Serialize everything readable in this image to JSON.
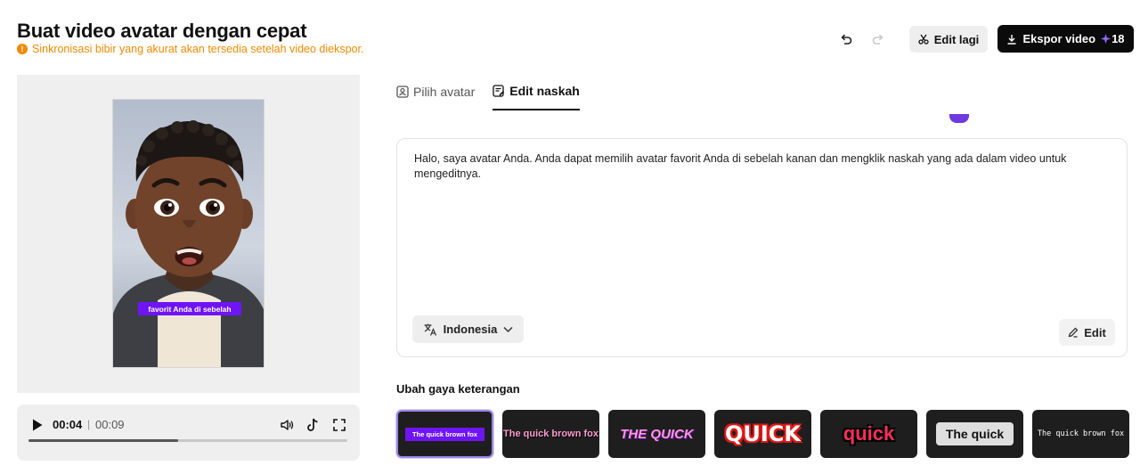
{
  "header": {
    "title": "Buat video avatar dengan cepat",
    "warning": "Sinkronisasi bibir yang akurat akan tersedia setelah video diekspor.",
    "edit_again_label": "Edit lagi",
    "export_label": "Ekspor video",
    "export_credits": "18"
  },
  "preview": {
    "caption": "favorit Anda di sebelah"
  },
  "player": {
    "current_time": "00:04",
    "separator": "|",
    "total_time": "00:09",
    "progress_fraction": 0.47
  },
  "tabs": [
    {
      "label": "Pilih avatar",
      "active": false
    },
    {
      "label": "Edit naskah",
      "active": true
    }
  ],
  "script": {
    "text": "Halo, saya avatar Anda. Anda dapat memilih avatar favorit Anda di sebelah kanan dan mengklik naskah yang ada dalam video untuk mengeditnya.",
    "language": "Indonesia",
    "edit_label": "Edit"
  },
  "caption_styles": {
    "title": "Ubah gaya keterangan",
    "items": [
      {
        "label": "The quick brown fox",
        "selected": true
      },
      {
        "label": "The quick brown fox",
        "selected": false
      },
      {
        "label": "THE QUICK",
        "selected": false
      },
      {
        "label": "QUICK",
        "selected": false
      },
      {
        "label": "quick",
        "selected": false
      },
      {
        "label": "The quick",
        "selected": false
      },
      {
        "label": "The quick brown fox",
        "selected": false
      }
    ]
  },
  "colors": {
    "accent_purple": "#6f14f5",
    "warning_orange": "#f08a00",
    "export_bg": "#0b0b0b"
  },
  "icons": {
    "undo": "undo-icon",
    "redo": "redo-icon",
    "edit_again": "scissors-icon",
    "export": "download-icon",
    "credits": "sparkle-icon",
    "play": "play-icon",
    "volume": "volume-icon",
    "tiktok": "tiktok-icon",
    "fullscreen": "fullscreen-icon",
    "language": "translate-icon",
    "edit": "pencil-icon"
  }
}
